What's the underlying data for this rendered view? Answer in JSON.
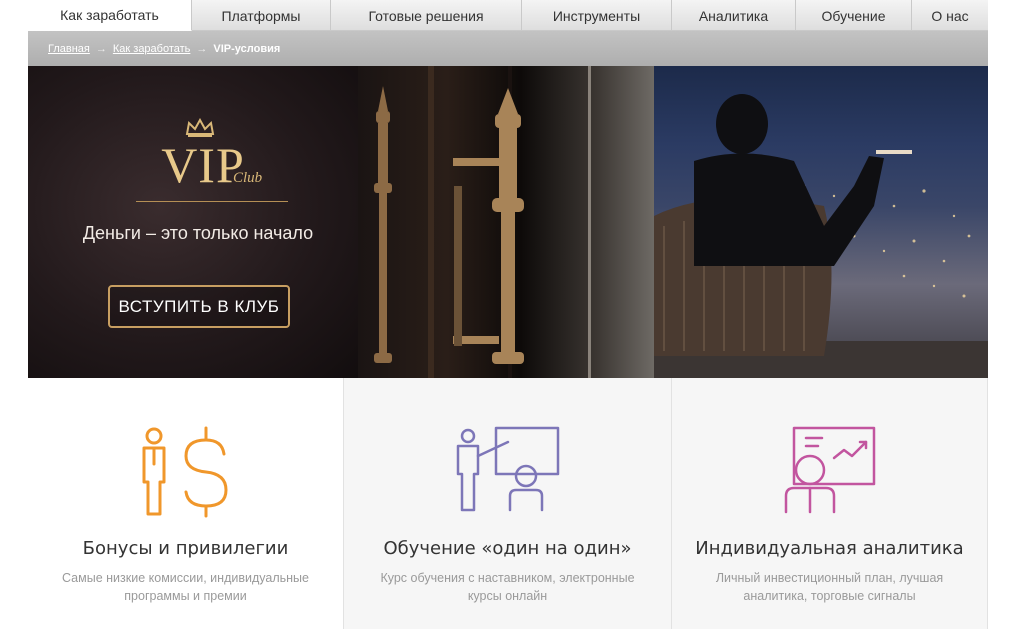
{
  "nav": {
    "tabs": [
      {
        "label": "Как заработать"
      },
      {
        "label": "Платформы"
      },
      {
        "label": "Готовые решения"
      },
      {
        "label": "Инструменты"
      },
      {
        "label": "Аналитика"
      },
      {
        "label": "Обучение"
      },
      {
        "label": "О нас"
      }
    ]
  },
  "breadcrumb": {
    "home": "Главная",
    "section": "Как заработать",
    "current": "VIP-условия",
    "separator": "→"
  },
  "hero": {
    "logo_main": "VIP",
    "logo_sub": "Club",
    "tagline": "Деньги – это только начало",
    "cta": "ВСТУПИТЬ В КЛУБ",
    "accent_color": "#c79e61"
  },
  "features": [
    {
      "title": "Бонусы и привилегии",
      "description": "Самые низкие комиссии, индивидуальные программы и премии",
      "icon": "person-dollar-icon",
      "color": "#f0972b"
    },
    {
      "title": "Обучение «один на один»",
      "description": "Курс обучения с наставником, электронные курсы онлайн",
      "icon": "mentor-board-icon",
      "color": "#7d76b8"
    },
    {
      "title": "Индивидуальная аналитика",
      "description": "Личный инвестиционный план, лучшая аналитика, торговые сигналы",
      "icon": "analytics-person-icon",
      "color": "#c2559f"
    }
  ]
}
